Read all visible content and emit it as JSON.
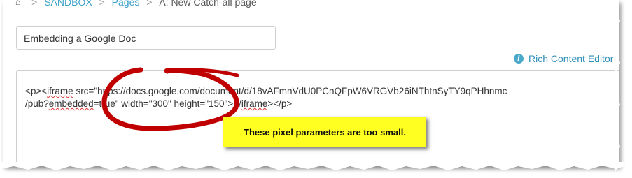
{
  "breadcrumb": {
    "home_icon": "home-icon",
    "items": [
      "SANDBOX",
      "Pages",
      "A: New Catch-all page"
    ],
    "separator": ">"
  },
  "title_input": {
    "value": "Embedding a Google Doc"
  },
  "rich_content_editor": {
    "icon": "info-icon",
    "label": "Rich Content Editor"
  },
  "editor": {
    "line1": {
      "pre": "<p><",
      "squiggle1": "iframe",
      "post": " src=\"https://docs.google.com/document/d/18vAFmnVdU0PCnQFpW6VRGVb26iNThtnSyTY9qPHhnmc"
    },
    "line2": {
      "pre": "/pub?",
      "squiggle1": "embedded",
      "mid": "=true\" width=\"300\" height=\"150\"></",
      "squiggle2": "iframe",
      "post": "></p>"
    }
  },
  "annotation": {
    "text": "These pixel parameters are too small.",
    "highlight_color": "#ffff22",
    "circle_color": "#c00000"
  }
}
